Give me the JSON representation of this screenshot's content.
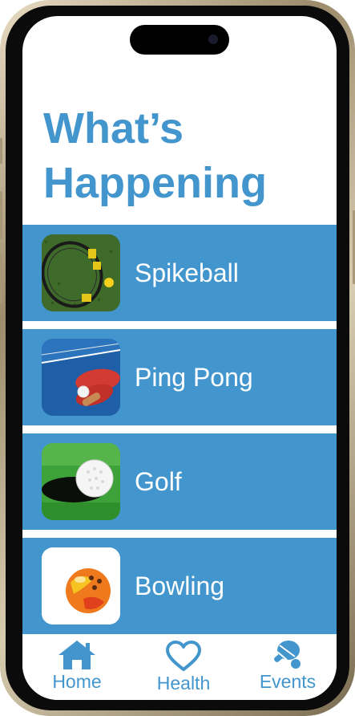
{
  "header": {
    "title_line1": "What’s",
    "title_line2": "Happening"
  },
  "events": [
    {
      "label": "Spikeball",
      "icon": "spikeball-photo"
    },
    {
      "label": "Ping Pong",
      "icon": "ping-pong-photo"
    },
    {
      "label": "Golf",
      "icon": "golf-photo"
    },
    {
      "label": "Bowling",
      "icon": "bowling-photo"
    }
  ],
  "tabbar": {
    "home_label": "Home",
    "health_label": "Health",
    "events_label": "Events"
  },
  "colors": {
    "accent": "#4396cd",
    "background": "#ffffff",
    "text_on_accent": "#ffffff"
  }
}
